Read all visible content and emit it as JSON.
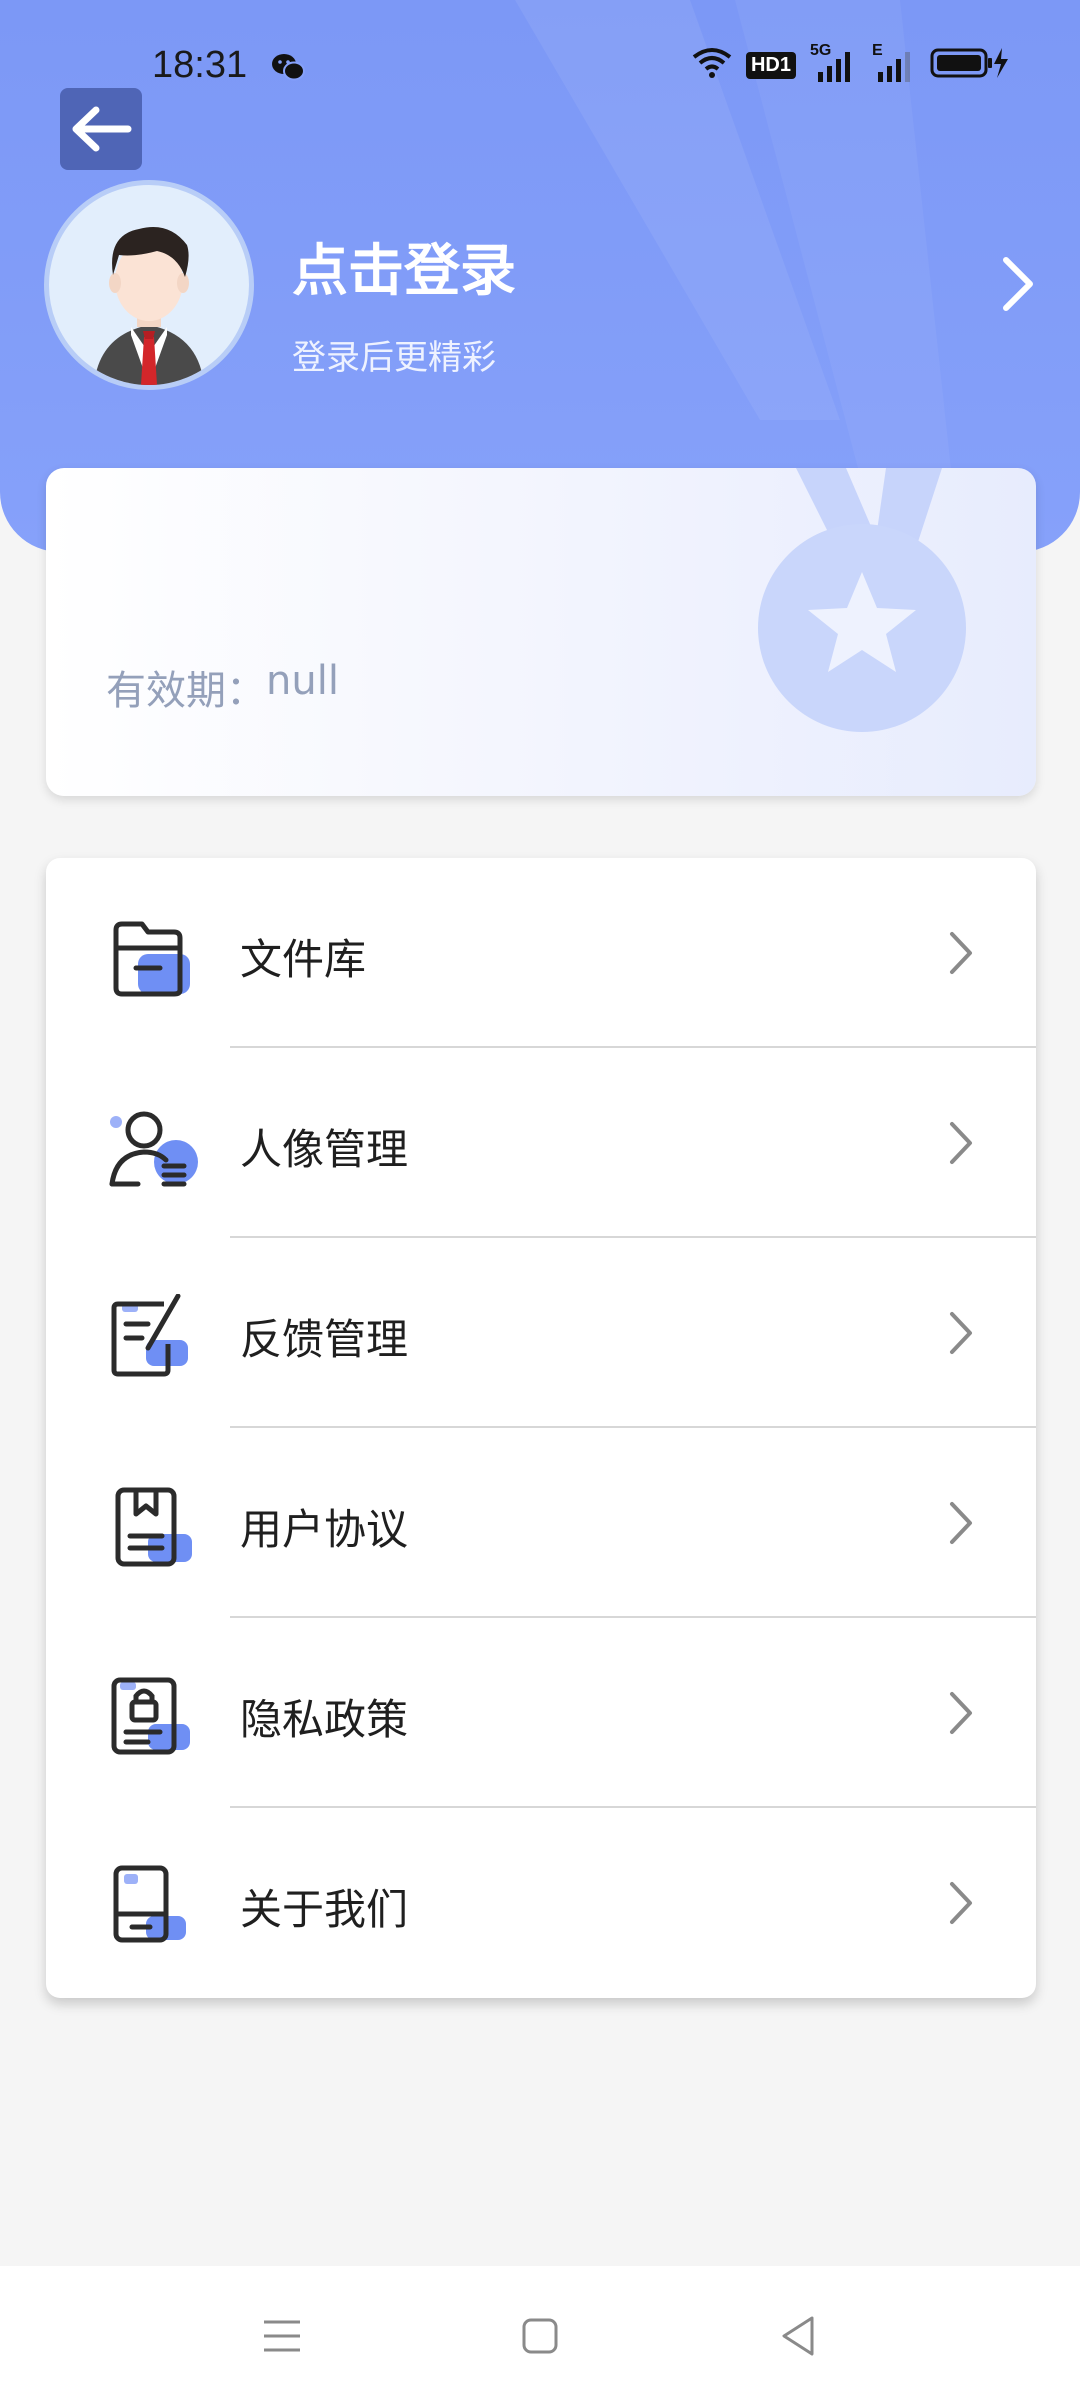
{
  "status": {
    "time": "18:31",
    "hd_badge": "HD1",
    "net_5g": "5G",
    "net_e": "E"
  },
  "header": {
    "login_title": "点击登录",
    "login_subtitle": "登录后更精彩"
  },
  "member": {
    "validity_label": "有效期：",
    "validity_value": "null"
  },
  "menu": {
    "items": [
      {
        "label": "文件库",
        "icon": "folder-icon"
      },
      {
        "label": "人像管理",
        "icon": "user-manage-icon"
      },
      {
        "label": "反馈管理",
        "icon": "feedback-icon"
      },
      {
        "label": "用户协议",
        "icon": "agreement-icon"
      },
      {
        "label": "隐私政策",
        "icon": "privacy-icon"
      },
      {
        "label": "关于我们",
        "icon": "about-icon"
      }
    ]
  },
  "colors": {
    "header_blue": "#7c98f6",
    "accent_blue": "#5b7ff0",
    "back_button": "#4f65b6"
  }
}
